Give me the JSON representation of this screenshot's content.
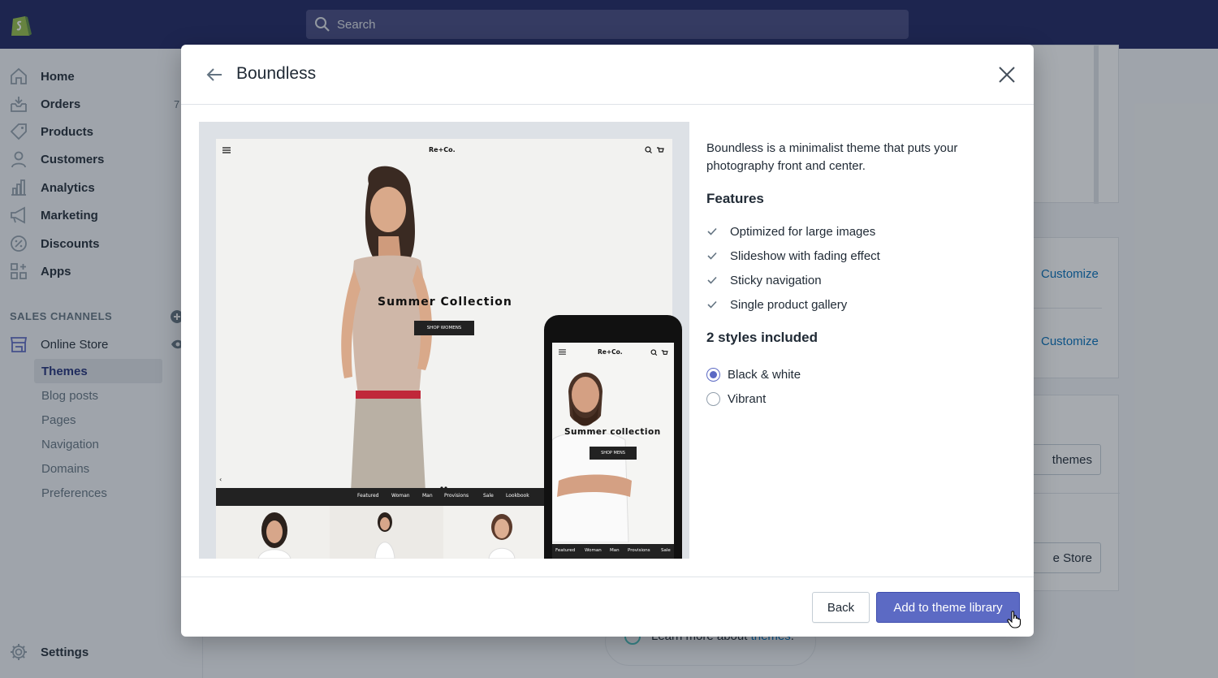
{
  "topbar": {
    "search_placeholder": "Search"
  },
  "sidebar": {
    "items": [
      {
        "label": "Home",
        "icon": "home-icon"
      },
      {
        "label": "Orders",
        "icon": "orders-icon",
        "badge": "7"
      },
      {
        "label": "Products",
        "icon": "tag-icon"
      },
      {
        "label": "Customers",
        "icon": "person-icon"
      },
      {
        "label": "Analytics",
        "icon": "bar-chart-icon"
      },
      {
        "label": "Marketing",
        "icon": "megaphone-icon"
      },
      {
        "label": "Discounts",
        "icon": "discount-icon"
      },
      {
        "label": "Apps",
        "icon": "apps-icon"
      }
    ],
    "sales_channels_heading": "SALES CHANNELS",
    "online_store": "Online Store",
    "sub_items": [
      "Themes",
      "Blog posts",
      "Pages",
      "Navigation",
      "Domains",
      "Preferences"
    ],
    "settings": "Settings"
  },
  "background": {
    "customize_1": "Customize",
    "customize_2": "Customize",
    "themes_btn": "themes",
    "store_btn": "e Store",
    "learn_more_prefix": "Learn more about ",
    "learn_more_link": "themes",
    "learn_more_suffix": "."
  },
  "modal": {
    "title": "Boundless",
    "description": "Boundless is a minimalist theme that puts your photography front and center.",
    "features_heading": "Features",
    "features": [
      "Optimized for large images",
      "Slideshow with fading effect",
      "Sticky navigation",
      "Single product gallery"
    ],
    "styles_heading": "2 styles included",
    "styles": [
      {
        "label": "Black & white",
        "selected": true
      },
      {
        "label": "Vibrant",
        "selected": false
      }
    ],
    "back_label": "Back",
    "primary_label": "Add to theme library",
    "accent_color": "#5c6ac4"
  },
  "preview": {
    "brand": "Re+Co.",
    "hero_title": "Summer Collection",
    "hero_button": "SHOP WOMENS",
    "nav": [
      "Featured",
      "Woman",
      "Man",
      "Provisions",
      "Sale",
      "Lookbook"
    ],
    "phone_brand": "Re+Co.",
    "phone_title": "Summer collection",
    "phone_button": "SHOP MENS",
    "phone_nav": [
      "Featured",
      "Woman",
      "Man",
      "Provisions",
      "Sale"
    ]
  }
}
